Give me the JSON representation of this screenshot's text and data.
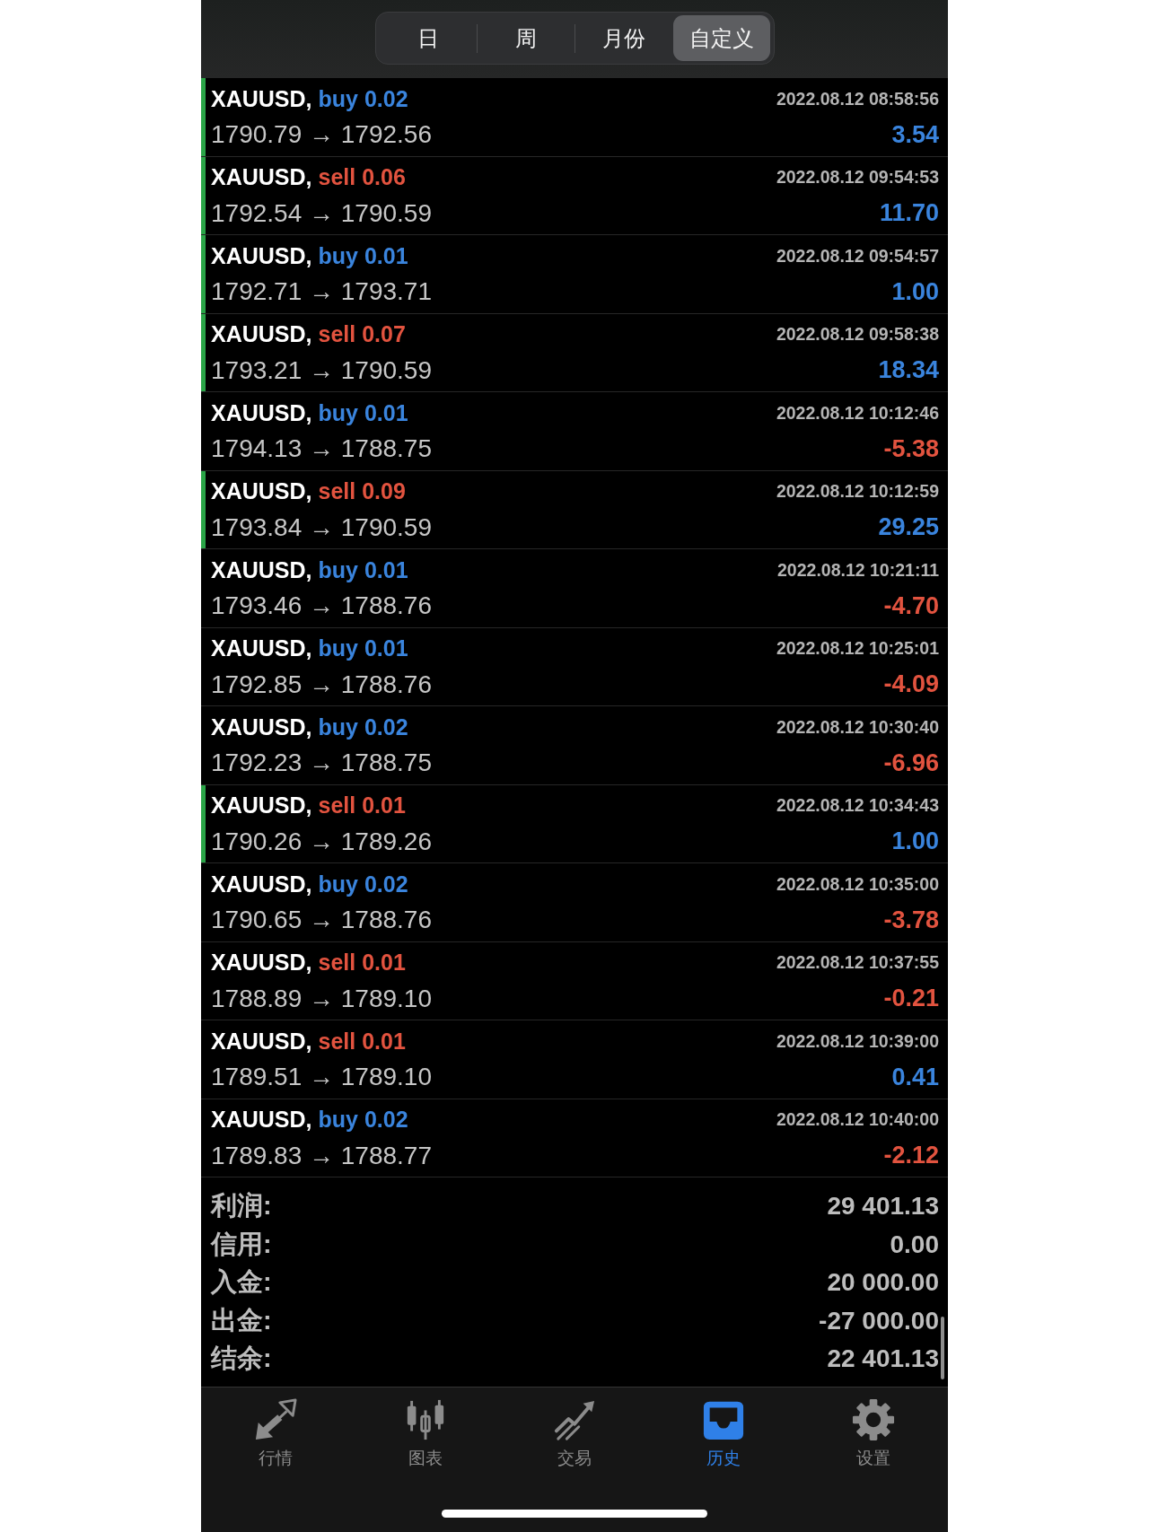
{
  "periods": [
    {
      "label": "日",
      "selected": false
    },
    {
      "label": "周",
      "selected": false
    },
    {
      "label": "月份",
      "selected": false
    },
    {
      "label": "自定义",
      "selected": true
    }
  ],
  "trades": [
    {
      "symbol": "XAUUSD,",
      "kind": "buy",
      "order": "buy 0.02",
      "time": "2022.08.12 08:58:56",
      "prices": "1790.79 → 1792.56",
      "profit": "3.54",
      "loss": false,
      "marked": true
    },
    {
      "symbol": "XAUUSD,",
      "kind": "sell",
      "order": "sell 0.06",
      "time": "2022.08.12 09:54:53",
      "prices": "1792.54 → 1790.59",
      "profit": "11.70",
      "loss": false,
      "marked": true
    },
    {
      "symbol": "XAUUSD,",
      "kind": "buy",
      "order": "buy 0.01",
      "time": "2022.08.12 09:54:57",
      "prices": "1792.71 → 1793.71",
      "profit": "1.00",
      "loss": false,
      "marked": true
    },
    {
      "symbol": "XAUUSD,",
      "kind": "sell",
      "order": "sell 0.07",
      "time": "2022.08.12 09:58:38",
      "prices": "1793.21 → 1790.59",
      "profit": "18.34",
      "loss": false,
      "marked": true
    },
    {
      "symbol": "XAUUSD,",
      "kind": "buy",
      "order": "buy 0.01",
      "time": "2022.08.12 10:12:46",
      "prices": "1794.13 → 1788.75",
      "profit": "-5.38",
      "loss": true,
      "marked": false
    },
    {
      "symbol": "XAUUSD,",
      "kind": "sell",
      "order": "sell 0.09",
      "time": "2022.08.12 10:12:59",
      "prices": "1793.84 → 1790.59",
      "profit": "29.25",
      "loss": false,
      "marked": true
    },
    {
      "symbol": "XAUUSD,",
      "kind": "buy",
      "order": "buy 0.01",
      "time": "2022.08.12 10:21:11",
      "prices": "1793.46 → 1788.76",
      "profit": "-4.70",
      "loss": true,
      "marked": false
    },
    {
      "symbol": "XAUUSD,",
      "kind": "buy",
      "order": "buy 0.01",
      "time": "2022.08.12 10:25:01",
      "prices": "1792.85 → 1788.76",
      "profit": "-4.09",
      "loss": true,
      "marked": false
    },
    {
      "symbol": "XAUUSD,",
      "kind": "buy",
      "order": "buy 0.02",
      "time": "2022.08.12 10:30:40",
      "prices": "1792.23 → 1788.75",
      "profit": "-6.96",
      "loss": true,
      "marked": false
    },
    {
      "symbol": "XAUUSD,",
      "kind": "sell",
      "order": "sell 0.01",
      "time": "2022.08.12 10:34:43",
      "prices": "1790.26 → 1789.26",
      "profit": "1.00",
      "loss": false,
      "marked": true
    },
    {
      "symbol": "XAUUSD,",
      "kind": "buy",
      "order": "buy 0.02",
      "time": "2022.08.12 10:35:00",
      "prices": "1790.65 → 1788.76",
      "profit": "-3.78",
      "loss": true,
      "marked": false
    },
    {
      "symbol": "XAUUSD,",
      "kind": "sell",
      "order": "sell 0.01",
      "time": "2022.08.12 10:37:55",
      "prices": "1788.89 → 1789.10",
      "profit": "-0.21",
      "loss": true,
      "marked": false
    },
    {
      "symbol": "XAUUSD,",
      "kind": "sell",
      "order": "sell 0.01",
      "time": "2022.08.12 10:39:00",
      "prices": "1789.51 → 1789.10",
      "profit": "0.41",
      "loss": false,
      "marked": false
    },
    {
      "symbol": "XAUUSD,",
      "kind": "buy",
      "order": "buy 0.02",
      "time": "2022.08.12 10:40:00",
      "prices": "1789.83 → 1788.77",
      "profit": "-2.12",
      "loss": true,
      "marked": false
    }
  ],
  "summary": [
    {
      "label": "利润:",
      "value": "29 401.13"
    },
    {
      "label": "信用:",
      "value": "0.00"
    },
    {
      "label": "入金:",
      "value": "20 000.00"
    },
    {
      "label": "出金:",
      "value": "-27 000.00"
    },
    {
      "label": "结余:",
      "value": "22 401.13"
    }
  ],
  "tab_bar": [
    {
      "kind": "quotes",
      "label": "行情",
      "selected": false
    },
    {
      "kind": "chart",
      "label": "图表",
      "selected": false
    },
    {
      "kind": "trade",
      "label": "交易",
      "selected": false
    },
    {
      "kind": "history",
      "label": "历史",
      "selected": true
    },
    {
      "kind": "settings",
      "label": "设置",
      "selected": false
    }
  ]
}
